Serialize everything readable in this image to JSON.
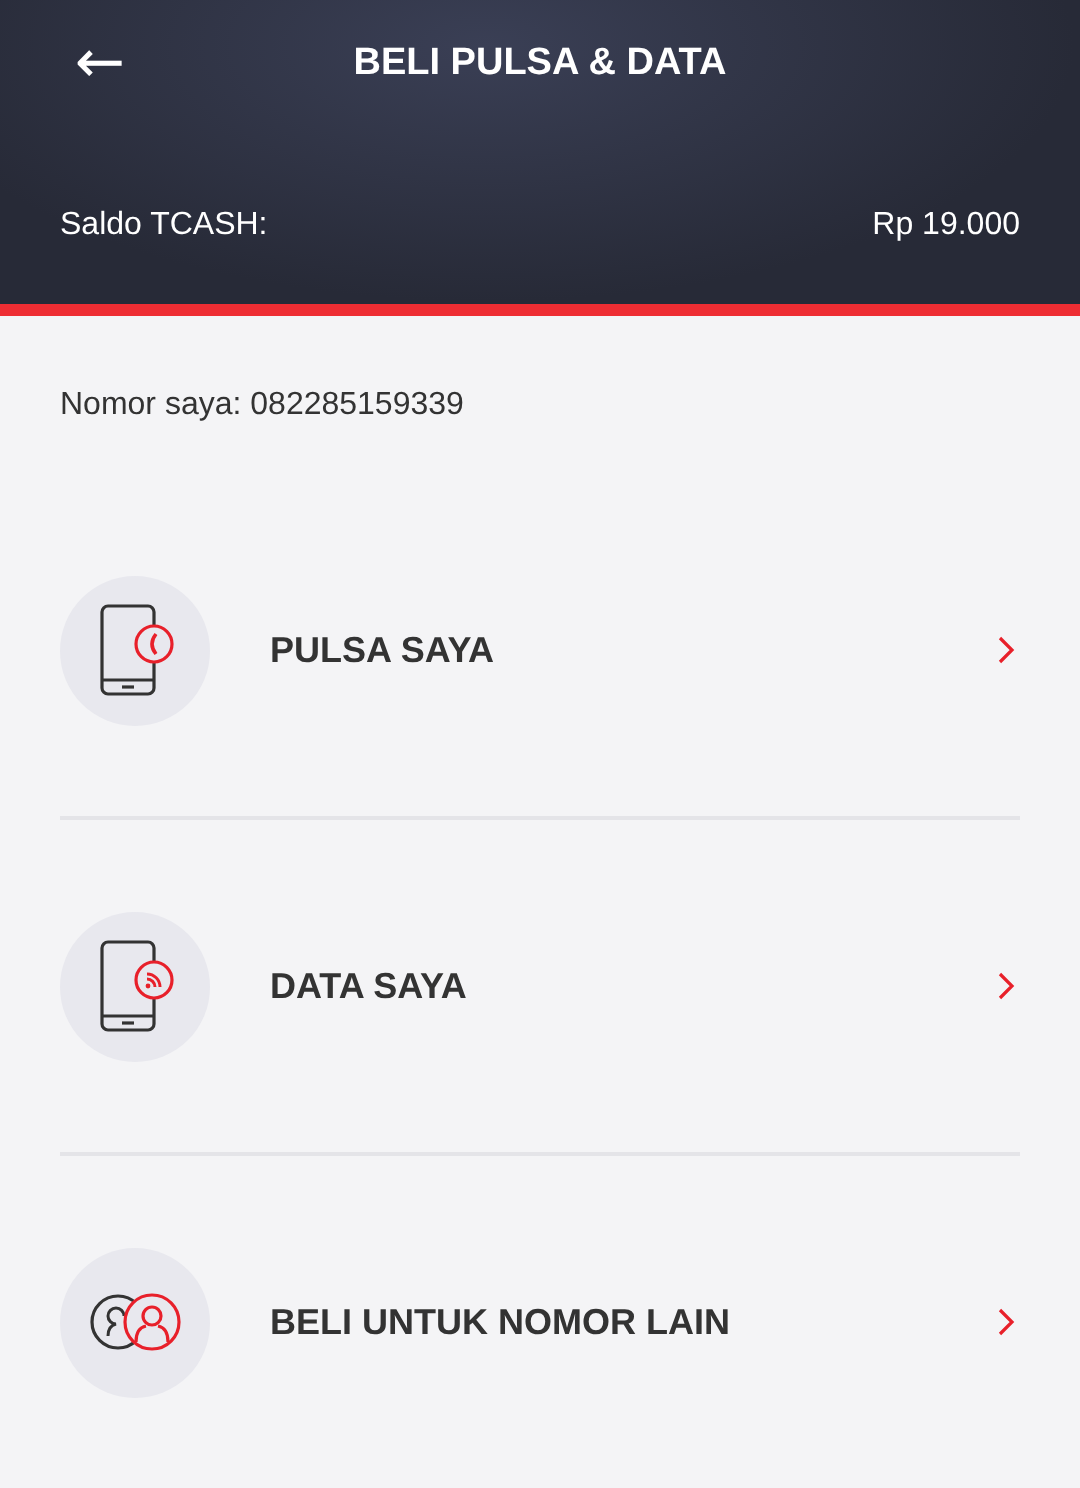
{
  "header": {
    "back": "←",
    "title": "BELI PULSA & DATA",
    "balance_label": "Saldo TCASH:",
    "balance_value": "Rp 19.000"
  },
  "my_number": "Nomor saya: 082285159339",
  "menu": [
    {
      "kind": "pulsa",
      "label": "PULSA SAYA"
    },
    {
      "kind": "data",
      "label": "DATA SAYA"
    },
    {
      "kind": "other",
      "label": "BELI UNTUK NOMOR LAIN"
    }
  ]
}
